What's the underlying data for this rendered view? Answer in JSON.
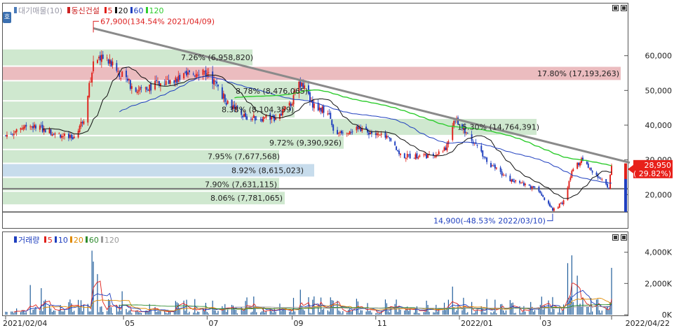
{
  "title_price": "대기매물(10)",
  "title_stock": "동신건설",
  "price_ma_legend": [
    {
      "label": "5",
      "color": "#e0201a"
    },
    {
      "label": "20",
      "color": "#111111"
    },
    {
      "label": "60",
      "color": "#1f3fbf"
    },
    {
      "label": "120",
      "color": "#2ecc2e"
    }
  ],
  "volume_title": "거래량",
  "volume_ma_legend": [
    {
      "label": "5",
      "color": "#e0201a"
    },
    {
      "label": "10",
      "color": "#1f3fbf"
    },
    {
      "label": "20",
      "color": "#e08a00"
    },
    {
      "label": "60",
      "color": "#2e8b2e"
    },
    {
      "label": "120",
      "color": "#9a9a9a"
    }
  ],
  "side_tab": "호",
  "chart_data": {
    "type": "candlestick",
    "x_start": "2021/02/04",
    "x_end": "2022/04/22",
    "x_ticks": [
      "2021/02/04",
      "05",
      "07",
      "09",
      "11",
      "2022/01",
      "03",
      "2022/04/22"
    ],
    "price_axis": {
      "ticks": [
        "20,000",
        "30,000",
        "40,000",
        "50,000",
        "60,000"
      ],
      "ylim": [
        12000,
        70000
      ]
    },
    "volume_axis": {
      "ticks": [
        "0K",
        "2,000K",
        "4,000K"
      ],
      "ylim": [
        0,
        4700
      ]
    },
    "current_price": "28,950",
    "current_change": "( 29.82%)",
    "annotations": {
      "high": "67,900(134.54% 2021/04/09)",
      "low": "14,900(-48.53% 2022/03/10)"
    },
    "high_point": {
      "date": "2021/04/09",
      "price": 67900
    },
    "low_point": {
      "date": "2022/03/10",
      "price": 14900
    },
    "volume_profile": [
      {
        "low": 57000,
        "high": 62000,
        "label": "7.26% (6,958,820)",
        "color": "green"
      },
      {
        "low": 52800,
        "high": 57000,
        "label": "17.80% (17,193,263)",
        "color": "red"
      },
      {
        "low": 47000,
        "high": 52800,
        "label": "8.78% (8,476,065)",
        "color": "green"
      },
      {
        "low": 42000,
        "high": 47000,
        "label": "8.38% (8,104,359)",
        "color": "green"
      },
      {
        "low": 37000,
        "high": 42000,
        "label": "15.30% (14,764,391)",
        "color": "green"
      },
      {
        "low": 33000,
        "high": 37000,
        "label": "9.72% (9,390,926)",
        "color": "green"
      },
      {
        "low": 29000,
        "high": 33000,
        "label": "7.95% (7,677,568)",
        "color": "green"
      },
      {
        "low": 25000,
        "high": 29000,
        "label": "8.92% (8,615,023)",
        "color": "blue"
      },
      {
        "low": 21000,
        "high": 25000,
        "label": "7.90% (7,631,115)",
        "color": "green"
      },
      {
        "low": 17000,
        "high": 21000,
        "label": "8.06% (7,781,065)",
        "color": "green"
      }
    ]
  }
}
